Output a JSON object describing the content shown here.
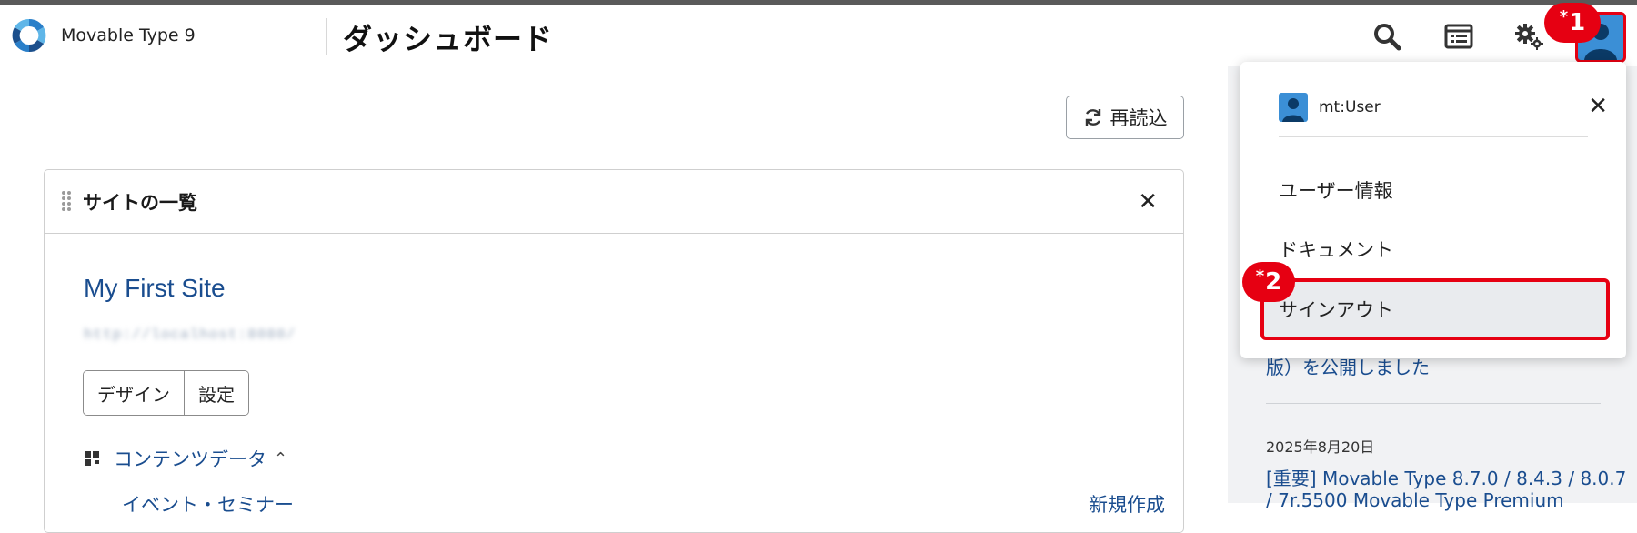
{
  "header": {
    "app_name": "Movable Type 9",
    "page_title": "ダッシュボード",
    "icons": [
      "search-icon",
      "list-icon",
      "gear-icon",
      "user-avatar-icon"
    ]
  },
  "annotations": {
    "badge1": "1",
    "badge2": "2",
    "asterisk": "*"
  },
  "toolbar": {
    "reload_label": "再読込"
  },
  "widget": {
    "title": "サイトの一覧",
    "site_name": "My First Site",
    "site_url": "http://localhost:8080/",
    "buttons": [
      "デザイン",
      "設定"
    ],
    "content_label": "コンテンツデータ",
    "cut_row_left": "イベント・セミナー",
    "cut_row_right": "新規作成"
  },
  "news": {
    "partial_line": "版）を公開しました",
    "date": "2025年8月20日",
    "link": "[重要] Movable Type 8.7.0 / 8.4.3 / 8.0.7",
    "link_cont": "/ 7r.5500 Movable Type Premium"
  },
  "user_menu": {
    "username": "mt:User",
    "items": [
      "ユーザー情報",
      "ドキュメント",
      "サインアウト"
    ]
  },
  "colors": {
    "accent_red": "#e60012",
    "link_blue": "#1a4d8f",
    "avatar_blue": "#3b8fd6"
  }
}
